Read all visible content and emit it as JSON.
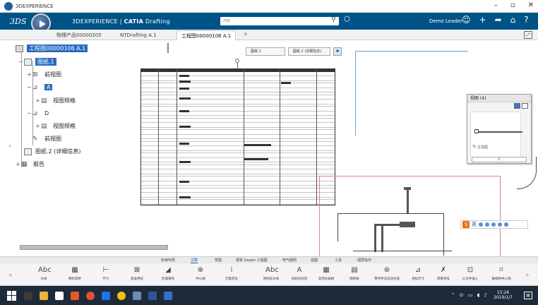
{
  "window": {
    "title": "3DEXPERIENCE"
  },
  "app": {
    "brand_prefix": "3DEXPERIENCE | ",
    "brand_bold": "CATIA",
    "brand_suffix": " Drafting",
    "search_placeholder": "搜索",
    "user": "Demo Leader"
  },
  "tabs": [
    {
      "label": "物理产品00000205"
    },
    {
      "label": "NTDrafting A.1"
    },
    {
      "label": "工程图00000106 A.1",
      "active": true
    }
  ],
  "tree": {
    "root": "工程图00000106 A.1",
    "sheet1": "图纸.1",
    "front_view_1": "前视图",
    "view_a": "A",
    "view_spec_1": "视图规格",
    "view_d": "D",
    "view_spec_2": "视图规格",
    "front_view_2": "前视图",
    "sheet2": "图纸.2 (详细信息)",
    "report": "报告"
  },
  "sheets": [
    {
      "label": "图纸.1"
    },
    {
      "label": "图纸.2 (详细信息)"
    }
  ],
  "panel": {
    "title": "视图 (4)",
    "edit_label": "主视图",
    "input_value": "0"
  },
  "ime": {
    "mode": "英"
  },
  "ribbon_tabs": [
    "标准布局",
    "注释",
    "草图",
    "更新 Isogen 工程图",
    "电气图例",
    "视图",
    "工具",
    "视屏操作"
  ],
  "ribbon_active": "注释",
  "tools": [
    {
      "icon": "Abc",
      "label": "文本"
    },
    {
      "icon": "▦",
      "label": "物料清单"
    },
    {
      "icon": "⊢",
      "label": "尺寸"
    },
    {
      "icon": "⊠",
      "label": "基准特征"
    },
    {
      "icon": "◢",
      "label": "区域填充"
    },
    {
      "icon": "⊕",
      "label": "中心线"
    },
    {
      "icon": "⁞",
      "label": "元素定位"
    },
    {
      "icon": "Abc",
      "label": "原则化文本"
    },
    {
      "icon": "A",
      "label": "初始化标签"
    },
    {
      "icon": "▦",
      "label": "实例化表格"
    },
    {
      "icon": "▤",
      "label": "图例表"
    },
    {
      "icon": "⊛",
      "label": "零件序号自动生成"
    },
    {
      "icon": "⊿",
      "label": "坐标尺寸"
    },
    {
      "icon": "✗",
      "label": "焊接符号"
    },
    {
      "icon": "⊡",
      "label": "从文件插入"
    },
    {
      "icon": "⌑",
      "label": "轴线和中心线"
    }
  ],
  "taskbar": {
    "time": "15:26",
    "date": "2019/1/7"
  },
  "colors": {
    "appbar": "#005386",
    "selection": "#2a6bc2",
    "taskbar": "#1c2a3a"
  }
}
